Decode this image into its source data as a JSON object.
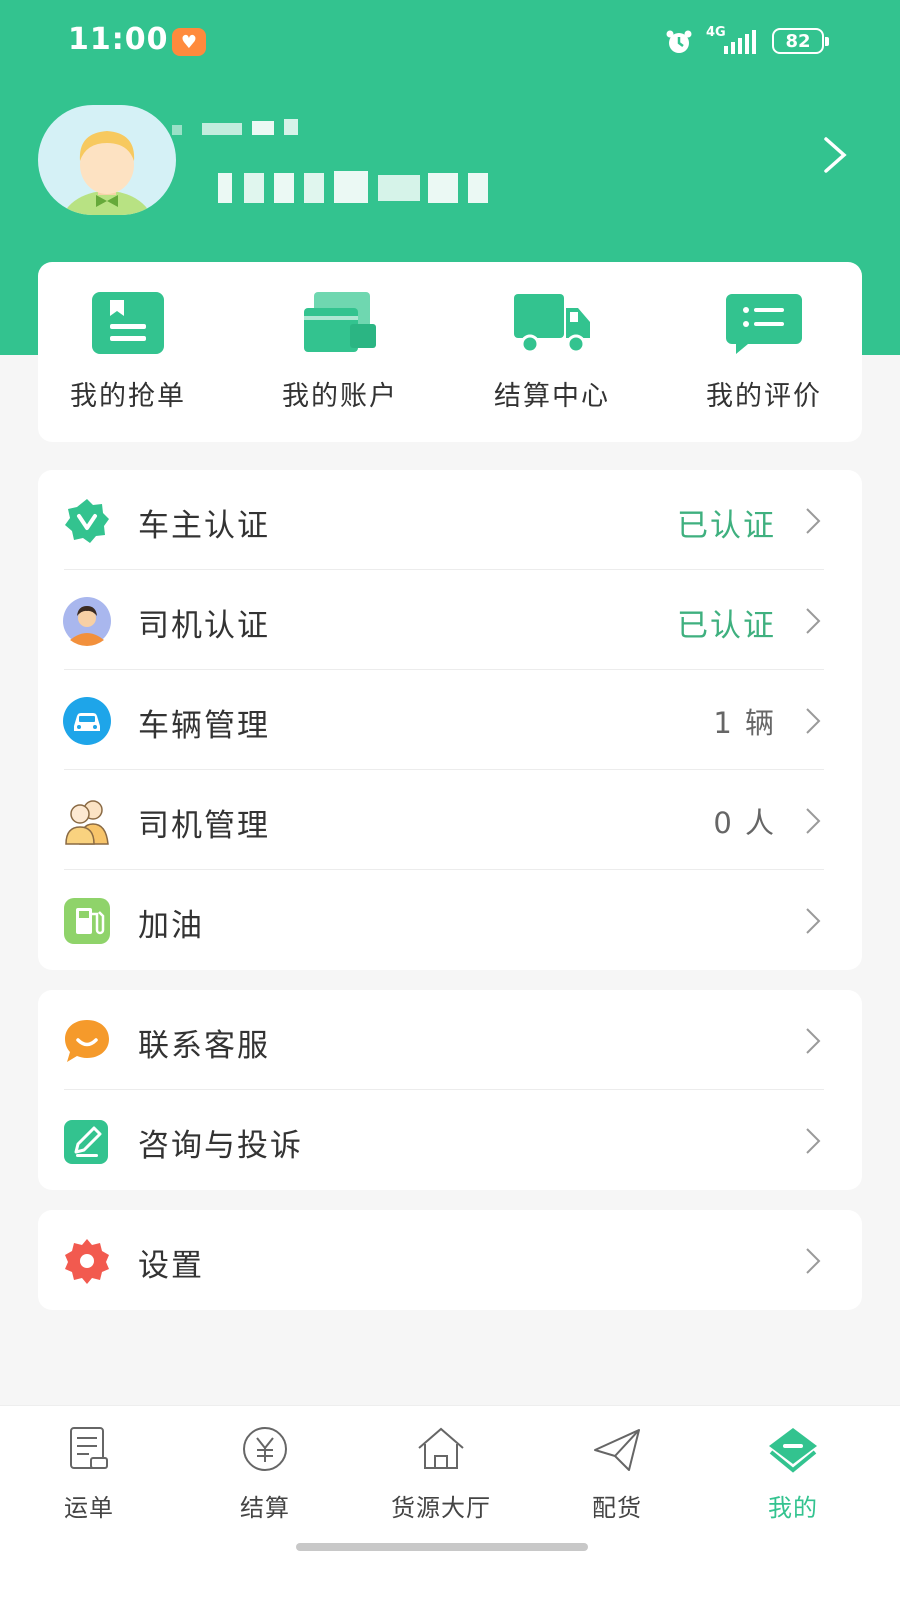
{
  "status_bar": {
    "time": "11:00",
    "network": "4G",
    "battery": "82"
  },
  "shortcuts": [
    {
      "label": "我的抢单",
      "icon": "order-icon"
    },
    {
      "label": "我的账户",
      "icon": "account-icon"
    },
    {
      "label": "结算中心",
      "icon": "truck-icon"
    },
    {
      "label": "我的评价",
      "icon": "comment-icon"
    }
  ],
  "menu": {
    "owner_cert": {
      "label": "车主认证",
      "value": "已认证",
      "icon": "verified-badge-icon"
    },
    "driver_cert": {
      "label": "司机认证",
      "value": "已认证",
      "icon": "driver-avatar-icon"
    },
    "vehicle_mgmt": {
      "label": "车辆管理",
      "value": "1 辆",
      "icon": "car-icon"
    },
    "driver_mgmt": {
      "label": "司机管理",
      "value": "0 人",
      "icon": "people-icon"
    },
    "fuel": {
      "label": "加油",
      "icon": "fuel-pump-icon"
    },
    "support": {
      "label": "联系客服",
      "icon": "chat-bubble-icon"
    },
    "complaint": {
      "label": "咨询与投诉",
      "icon": "edit-icon"
    },
    "settings": {
      "label": "设置",
      "icon": "gear-icon"
    }
  },
  "tabs": [
    {
      "label": "运单",
      "icon": "waybill-icon"
    },
    {
      "label": "结算",
      "icon": "yuan-icon"
    },
    {
      "label": "货源大厅",
      "icon": "home-icon"
    },
    {
      "label": "配货",
      "icon": "send-icon"
    },
    {
      "label": "我的",
      "icon": "profile-icon",
      "active": true
    }
  ],
  "colors": {
    "brand": "#33c38f",
    "verified_text": "#3fb07f",
    "background": "#f6f6f6"
  }
}
